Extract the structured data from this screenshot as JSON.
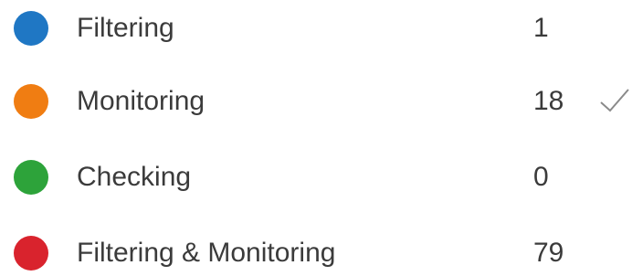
{
  "legend": {
    "items": [
      {
        "label": "Filtering",
        "count": "1",
        "color": "#1f77c4",
        "selected": false
      },
      {
        "label": "Monitoring",
        "count": "18",
        "color": "#f07d12",
        "selected": true
      },
      {
        "label": "Checking",
        "count": "0",
        "color": "#2da33a",
        "selected": false
      },
      {
        "label": "Filtering & Monitoring",
        "count": "79",
        "color": "#d9232d",
        "selected": false
      }
    ],
    "selected_icon": "check-icon"
  }
}
